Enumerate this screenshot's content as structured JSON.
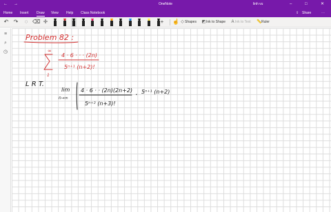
{
  "titlebar": {
    "back_glyph": "←",
    "forward_glyph": "→",
    "app_title": "OneNote",
    "user": "linh vu",
    "minimize_glyph": "–",
    "maximize_glyph": "□",
    "close_glyph": "✕"
  },
  "menu": {
    "items": [
      {
        "label": "Home"
      },
      {
        "label": "Insert"
      },
      {
        "label": "Draw",
        "active": true
      },
      {
        "label": "View"
      },
      {
        "label": "Help"
      },
      {
        "label": "Class Notebook"
      }
    ],
    "share_label": "Share",
    "more_glyph": "⋯"
  },
  "toolbar": {
    "undo_glyph": "↶",
    "redo_glyph": "↷",
    "add_pen_glyph": "+",
    "shapes_label": "Shapes",
    "ink_to_shape_label": "Ink to Shape",
    "ink_to_text_label": "Ink to Text",
    "ruler_label": "Ruler",
    "pens": [
      {
        "color": "#111111"
      },
      {
        "color": "#d32f2f"
      },
      {
        "color": "#111111",
        "selected": true
      },
      {
        "color": "#111111"
      },
      {
        "color": "#e91e63"
      },
      {
        "color": "#111111"
      },
      {
        "color": "#ff9800"
      },
      {
        "color": "#111111"
      },
      {
        "color": "#1e88e5"
      },
      {
        "color": "#111111"
      },
      {
        "color": "#ffeb3b"
      },
      {
        "color": "#111111"
      }
    ]
  },
  "sidebar": {
    "hamburger_glyph": "≡",
    "search_glyph": "⌕",
    "recent_glyph": "◷"
  },
  "note": {
    "heading": "Problem 82 :",
    "series": {
      "sigma_upper": "∞",
      "sigma_lower": "1",
      "numerator": "4 · 6 · · · (2n)",
      "denominator": "5ⁿ⁺¹ (n+2)!"
    },
    "lrt_label": "L R T.",
    "limit": {
      "lim": "lim",
      "sub": "n→∞",
      "numerator": "4 · 6 · · (2n)(2n+2)",
      "denominator": "5ⁿ⁺² (n+3)!",
      "times": "·",
      "multiplier": "5ⁿ⁺¹ (n+2)"
    }
  }
}
